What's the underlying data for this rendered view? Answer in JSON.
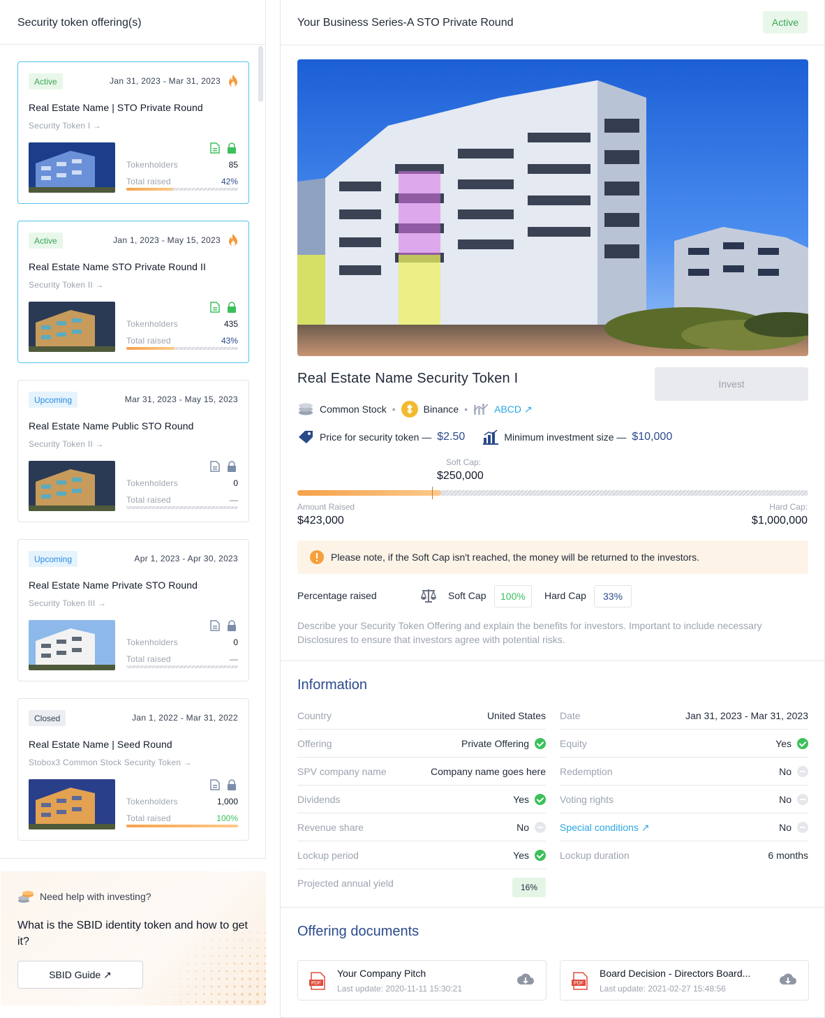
{
  "left": {
    "title": "Security token offering(s)",
    "cards": [
      {
        "status": "Active",
        "date": "Jan 31, 2023 - Mar 31, 2023",
        "title": "Real Estate Name | STO Private Round",
        "token": "Security Token I →",
        "holders_label": "Tokenholders",
        "holders": "85",
        "raised_label": "Total raised",
        "raised": "42%",
        "progress": 0.42
      },
      {
        "status": "Active",
        "date": "Jan 1, 2023 - May 15, 2023",
        "title": "Real Estate Name STO Private Round II",
        "token": "Security Token II →",
        "holders_label": "Tokenholders",
        "holders": "435",
        "raised_label": "Total raised",
        "raised": "43%",
        "progress": 0.43
      },
      {
        "status": "Upcoming",
        "date": "Mar 31, 2023 - May 15, 2023",
        "title": "Real Estate Name Public STO Round",
        "token": "Security Token II →",
        "holders_label": "Tokenholders",
        "holders": "0",
        "raised_label": "Total raised",
        "raised": "—",
        "progress": 0
      },
      {
        "status": "Upcoming",
        "date": "Apr 1, 2023 - Apr 30, 2023",
        "title": "Real Estate Name Private STO Round",
        "token": "Security Token III →",
        "holders_label": "Tokenholders",
        "holders": "0",
        "raised_label": "Total raised",
        "raised": "—",
        "progress": 0
      },
      {
        "status": "Closed",
        "date": "Jan 1, 2022 - Mar 31, 2022",
        "title": "Real Estate Name | Seed Round",
        "token": "Stobox3 Common Stock Security Token →",
        "holders_label": "Tokenholders",
        "holders": "1,000",
        "raised_label": "Total raised",
        "raised": "100%",
        "progress": 1.0
      }
    ]
  },
  "help": {
    "kicker": "Need help with investing?",
    "question": "What is the SBID identity token and how to get it?",
    "button": "SBID Guide ↗"
  },
  "header": {
    "title": "Your Business Series-A STO Private Round",
    "status": "Active"
  },
  "token": {
    "name": "Real Estate Name Security Token I",
    "invest": "Invest",
    "type": "Common Stock",
    "chain": "Binance",
    "ticker": "ABCD ↗",
    "price_label": "Price for security token —",
    "price": "$2.50",
    "min_label": "Minimum investment size —",
    "min": "$10,000"
  },
  "raise": {
    "soft_cap_label": "Soft Cap:",
    "soft_cap": "$250,000",
    "amount_label": "Amount Raised",
    "amount": "$423,000",
    "hard_cap_label": "Hard Cap:",
    "hard_cap": "$1,000,000",
    "progress": 0.423,
    "soft_cap_fraction": 0.25,
    "note": "Please note, if the Soft Cap isn't reached, the money will be returned to the investors.",
    "pct_label": "Percentage raised",
    "soft_pct_label": "Soft Cap",
    "soft_pct": "100%",
    "hard_pct_label": "Hard Cap",
    "hard_pct": "33%",
    "description": "Describe your Security Token Offering and explain the benefits for investors. Important to include necessary Disclosures to ensure that investors agree with potential risks."
  },
  "information": {
    "title": "Information",
    "left": [
      {
        "k": "Country",
        "v": "United States",
        "icon": ""
      },
      {
        "k": "Offering",
        "v": "Private Offering",
        "icon": "check"
      },
      {
        "k": "SPV company name",
        "v": "Company name goes here",
        "icon": ""
      },
      {
        "k": "Dividends",
        "v": "Yes",
        "icon": "check"
      },
      {
        "k": "Revenue share",
        "v": "No",
        "icon": "no"
      },
      {
        "k": "Lockup period",
        "v": "Yes",
        "icon": "check"
      },
      {
        "k": "Projected annual yield",
        "v": "16%",
        "icon": "pill"
      }
    ],
    "right": [
      {
        "k": "Date",
        "v": "Jan 31, 2023 - Mar 31, 2023",
        "icon": ""
      },
      {
        "k": "Equity",
        "v": "Yes",
        "icon": "check"
      },
      {
        "k": "Redemption",
        "v": "No",
        "icon": "no"
      },
      {
        "k": "Voting rights",
        "v": "No",
        "icon": "no"
      },
      {
        "k": "Special conditions ↗",
        "v": "No",
        "icon": "no"
      },
      {
        "k": "Lockup duration",
        "v": "6 months",
        "icon": ""
      }
    ]
  },
  "documents": {
    "title": "Offering documents",
    "items": [
      {
        "name": "Your Company Pitch",
        "updated": "Last update: 2020-11-11 15:30:21"
      },
      {
        "name": "Board Decision - Directors Board...",
        "updated": "Last update: 2021-02-27 15:48:56"
      }
    ]
  },
  "colors": {
    "accent": "#2b4a8b",
    "link": "#2aa7e0",
    "green": "#3cc05b",
    "orange": "#f6a14a"
  }
}
